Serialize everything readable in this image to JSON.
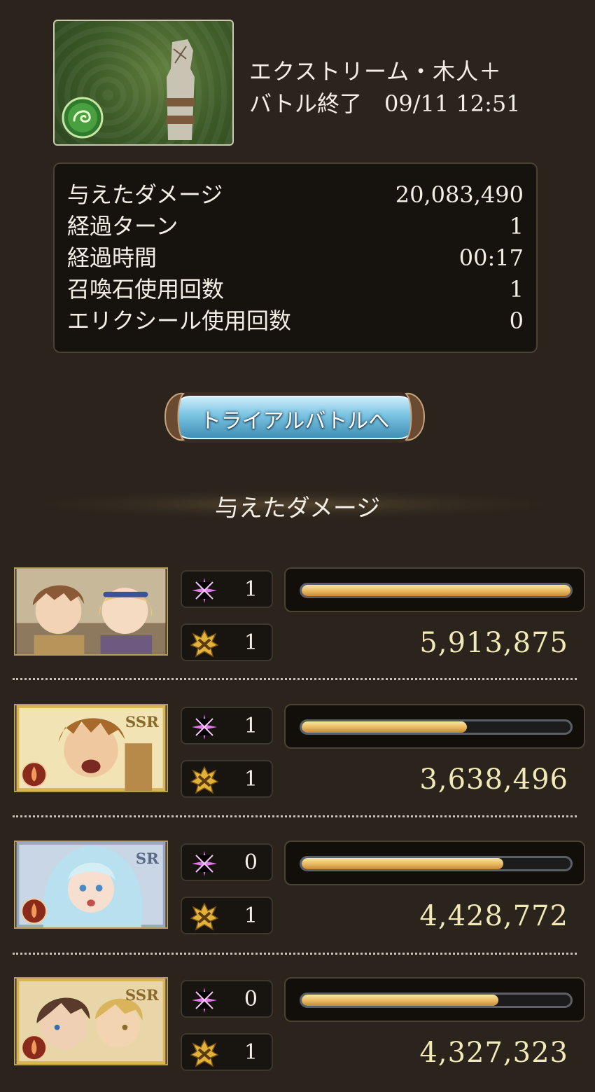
{
  "quest": {
    "title": "エクストリーム・木人＋",
    "status": "バトル終了",
    "datetime": "09/11 12:51",
    "element_icon": "wind-element-icon",
    "colors": {
      "panel_border": "#4a4233",
      "bar_fill": "#e7b85e",
      "damage_text": "#f2e9b8"
    }
  },
  "stats": [
    {
      "label": "与えたダメージ",
      "value": "20,083,490"
    },
    {
      "label": "経過ターン",
      "value": "1"
    },
    {
      "label": "経過時間",
      "value": "00:17"
    },
    {
      "label": "召喚石使用回数",
      "value": "1"
    },
    {
      "label": "エリクシール使用回数",
      "value": "0"
    }
  ],
  "trial_button": {
    "label": "トライアルバトルへ"
  },
  "section": {
    "title": "与えたダメージ"
  },
  "characters": [
    {
      "portrait": "gran-djeeta-portrait",
      "rarity": "",
      "element": "",
      "sparkle": "1",
      "ougi": "1",
      "damage": "5,913,875",
      "share": 1.0
    },
    {
      "portrait": "fire-ssr-portrait",
      "rarity": "SSR",
      "element": "fire",
      "sparkle": "1",
      "ougi": "1",
      "damage": "3,638,496",
      "share": 0.615
    },
    {
      "portrait": "fire-sr-portrait",
      "rarity": "SR",
      "element": "fire",
      "sparkle": "0",
      "ougi": "1",
      "damage": "4,428,772",
      "share": 0.749
    },
    {
      "portrait": "fire-ssr-duo-portrait",
      "rarity": "SSR",
      "element": "fire",
      "sparkle": "0",
      "ougi": "1",
      "damage": "4,327,323",
      "share": 0.732
    }
  ]
}
